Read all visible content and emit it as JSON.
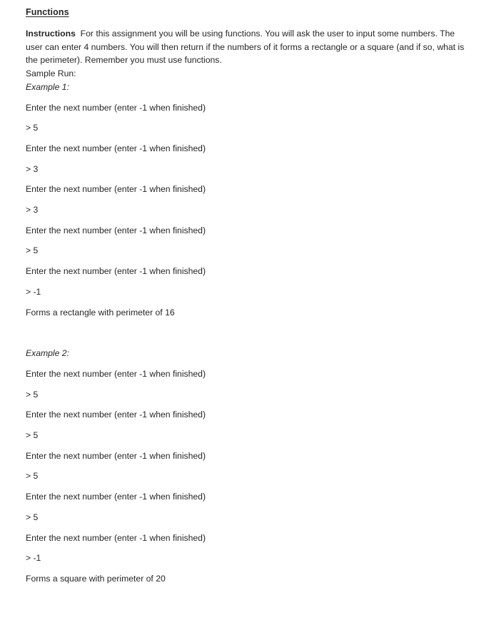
{
  "document": {
    "title": "Functions",
    "instructions": {
      "label": "Instructions",
      "body": "For this assignment you will be using functions. You will ask the user to input some numbers. The user can enter 4 numbers. You will then return if the numbers of it forms a rectangle or a square (and if so, what is the perimeter). Remember you must use functions."
    },
    "sample_run_label": "Sample Run:",
    "examples": [
      {
        "heading": "Example 1:",
        "lines": [
          "Enter the next number (enter -1 when finished)",
          "> 5",
          "Enter the next number (enter -1 when finished)",
          "> 3",
          "Enter the next number (enter -1 when finished)",
          "> 3",
          "Enter the next number (enter -1 when finished)",
          "> 5",
          "Enter the next number (enter -1 when finished)",
          "> -1"
        ],
        "result": "Forms a rectangle with perimeter of 16"
      },
      {
        "heading": "Example 2:",
        "lines": [
          "Enter the next number (enter -1 when finished)",
          "> 5",
          "Enter the next number (enter -1 when finished)",
          "> 5",
          "Enter the next number (enter -1 when finished)",
          "> 5",
          "Enter the next number (enter -1 when finished)",
          "> 5",
          "Enter the next number (enter -1 when finished)",
          "> -1"
        ],
        "result": "Forms a square with perimeter of 20"
      }
    ]
  }
}
